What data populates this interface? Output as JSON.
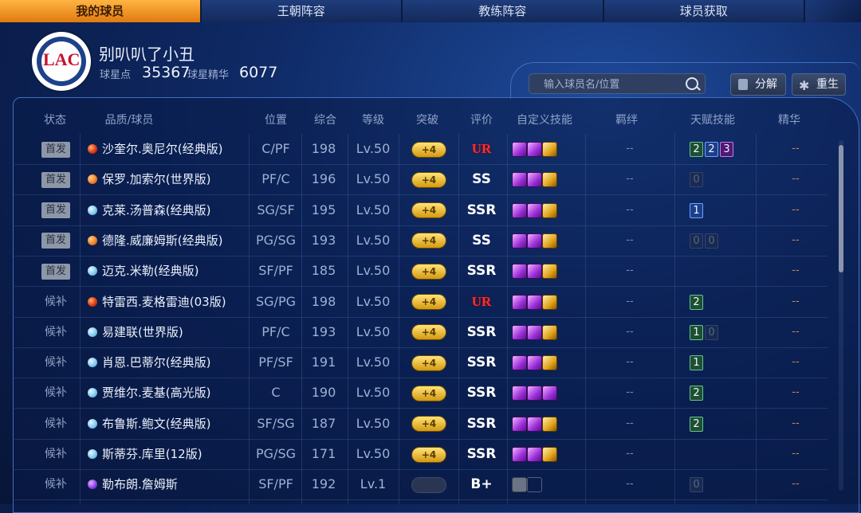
{
  "tabs": [
    "我的球员",
    "王朝阵容",
    "教练阵容",
    "球员获取"
  ],
  "profile": {
    "name": "别叭叭了小丑",
    "star_points_label": "球星点",
    "star_points": "35367",
    "essence_label": "球星精华",
    "essence": "6077",
    "team_logo_text": "LAC"
  },
  "search": {
    "placeholder": "输入球员名/位置"
  },
  "actions": {
    "decompose": "分解",
    "rebirth": "重生"
  },
  "columns": [
    "状态",
    "品质/球员",
    "位置",
    "综合",
    "等级",
    "突破",
    "评价",
    "自定义技能",
    "羁绊",
    "天赋技能",
    "精华"
  ],
  "rows": [
    {
      "status": "首发",
      "starter": true,
      "quality": "red",
      "name": "沙奎尔.奥尼尔(经典版)",
      "pos": "C/PF",
      "ovr": "198",
      "level": "Lv.50",
      "breakthrough": "+4",
      "rating": "UR",
      "rating_class": "ur",
      "skills": [
        "p",
        "p",
        "g"
      ],
      "bond": "--",
      "talents": [
        [
          "2",
          "g"
        ],
        [
          "2",
          "b"
        ],
        [
          "3",
          "p"
        ]
      ],
      "essence": "--"
    },
    {
      "status": "首发",
      "starter": true,
      "quality": "orange",
      "name": "保罗.加索尔(世界版)",
      "pos": "PF/C",
      "ovr": "196",
      "level": "Lv.50",
      "breakthrough": "+4",
      "rating": "SS",
      "rating_class": "ss",
      "skills": [
        "p",
        "p",
        "g"
      ],
      "bond": "--",
      "talents": [
        [
          "0",
          "x"
        ]
      ],
      "essence": "--"
    },
    {
      "status": "首发",
      "starter": true,
      "quality": "blue",
      "name": "克莱.汤普森(经典版)",
      "pos": "SG/SF",
      "ovr": "195",
      "level": "Lv.50",
      "breakthrough": "+4",
      "rating": "SSR",
      "rating_class": "ssr",
      "skills": [
        "p",
        "p",
        "g"
      ],
      "bond": "--",
      "talents": [
        [
          "1",
          "b"
        ]
      ],
      "essence": "--"
    },
    {
      "status": "首发",
      "starter": true,
      "quality": "orange",
      "name": "德隆.威廉姆斯(经典版)",
      "pos": "PG/SG",
      "ovr": "193",
      "level": "Lv.50",
      "breakthrough": "+4",
      "rating": "SS",
      "rating_class": "ss",
      "skills": [
        "p",
        "p",
        "g"
      ],
      "bond": "--",
      "talents": [
        [
          "0",
          "x"
        ],
        [
          "0",
          "x"
        ]
      ],
      "essence": "--"
    },
    {
      "status": "首发",
      "starter": true,
      "quality": "blue",
      "name": "迈克.米勒(经典版)",
      "pos": "SF/PF",
      "ovr": "185",
      "level": "Lv.50",
      "breakthrough": "+4",
      "rating": "SSR",
      "rating_class": "ssr",
      "skills": [
        "p",
        "p",
        "g"
      ],
      "bond": "--",
      "talents": [],
      "essence": "--"
    },
    {
      "status": "候补",
      "starter": false,
      "quality": "red",
      "name": "特雷西.麦格雷迪(03版)",
      "pos": "SG/PG",
      "ovr": "198",
      "level": "Lv.50",
      "breakthrough": "+4",
      "rating": "UR",
      "rating_class": "ur",
      "skills": [
        "p",
        "p",
        "g"
      ],
      "bond": "--",
      "talents": [
        [
          "2",
          "g"
        ]
      ],
      "essence": "--"
    },
    {
      "status": "候补",
      "starter": false,
      "quality": "blue",
      "name": "易建联(世界版)",
      "pos": "PF/C",
      "ovr": "193",
      "level": "Lv.50",
      "breakthrough": "+4",
      "rating": "SSR",
      "rating_class": "ssr",
      "skills": [
        "p",
        "p",
        "g"
      ],
      "bond": "--",
      "talents": [
        [
          "1",
          "g"
        ],
        [
          "0",
          "x"
        ]
      ],
      "essence": "--"
    },
    {
      "status": "候补",
      "starter": false,
      "quality": "blue",
      "name": "肖恩.巴蒂尔(经典版)",
      "pos": "PF/SF",
      "ovr": "191",
      "level": "Lv.50",
      "breakthrough": "+4",
      "rating": "SSR",
      "rating_class": "ssr",
      "skills": [
        "p",
        "p",
        "g"
      ],
      "bond": "--",
      "talents": [
        [
          "1",
          "g"
        ]
      ],
      "essence": "--"
    },
    {
      "status": "候补",
      "starter": false,
      "quality": "blue",
      "name": "贾维尔.麦基(高光版)",
      "pos": "C",
      "ovr": "190",
      "level": "Lv.50",
      "breakthrough": "+4",
      "rating": "SSR",
      "rating_class": "ssr",
      "skills": [
        "p",
        "p",
        "p"
      ],
      "bond": "--",
      "talents": [
        [
          "2",
          "g"
        ]
      ],
      "essence": "--"
    },
    {
      "status": "候补",
      "starter": false,
      "quality": "blue",
      "name": "布鲁斯.鲍文(经典版)",
      "pos": "SF/SG",
      "ovr": "187",
      "level": "Lv.50",
      "breakthrough": "+4",
      "rating": "SSR",
      "rating_class": "ssr",
      "skills": [
        "p",
        "p",
        "g"
      ],
      "bond": "--",
      "talents": [
        [
          "2",
          "g"
        ]
      ],
      "essence": "--"
    },
    {
      "status": "候补",
      "starter": false,
      "quality": "blue",
      "name": "斯蒂芬.库里(12版)",
      "pos": "PG/SG",
      "ovr": "171",
      "level": "Lv.50",
      "breakthrough": "+4",
      "rating": "SSR",
      "rating_class": "ssr",
      "skills": [
        "p",
        "p",
        "g"
      ],
      "bond": "--",
      "talents": [],
      "essence": "--"
    },
    {
      "status": "候补",
      "starter": false,
      "quality": "purple",
      "name": "勒布朗.詹姆斯",
      "pos": "SF/PF",
      "ovr": "192",
      "level": "Lv.1",
      "breakthrough": "",
      "rating": "B+",
      "rating_class": "bp",
      "skills": [
        "lock",
        "empty"
      ],
      "bond": "--",
      "talents": [
        [
          "0",
          "x"
        ]
      ],
      "essence": "--"
    }
  ]
}
